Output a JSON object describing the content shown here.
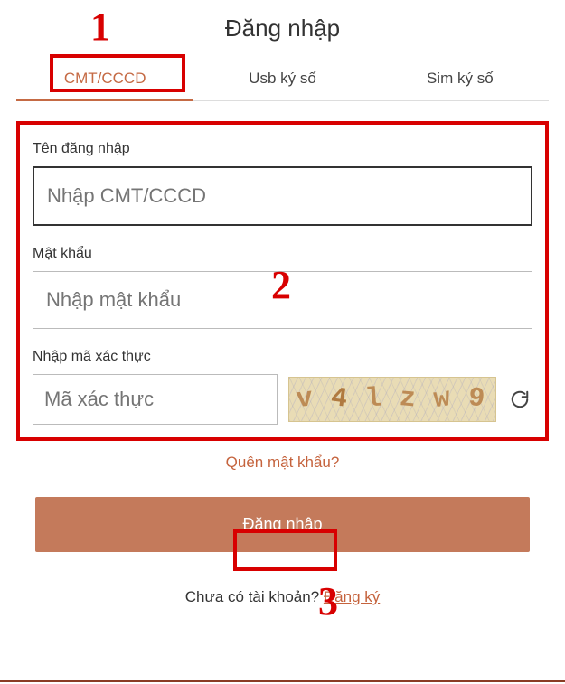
{
  "title": "Đăng nhập",
  "tabs": {
    "cmt": "CMT/CCCD",
    "usb": "Usb ký số",
    "sim": "Sim ký số"
  },
  "form": {
    "username_label": "Tên đăng nhập",
    "username_placeholder": "Nhập CMT/CCCD",
    "password_label": "Mật khẩu",
    "password_placeholder": "Nhập mật khẩu",
    "captcha_label": "Nhập mã xác thực",
    "captcha_placeholder": "Mã xác thực",
    "captcha_value": "v4lzw9"
  },
  "links": {
    "forgot": "Quên mật khẩu?",
    "no_account": "Chưa có tài khoản? ",
    "register": "Đăng ký"
  },
  "buttons": {
    "login": "Đăng nhập"
  },
  "annotations": {
    "n1": "1",
    "n2": "2",
    "n3": "3"
  }
}
